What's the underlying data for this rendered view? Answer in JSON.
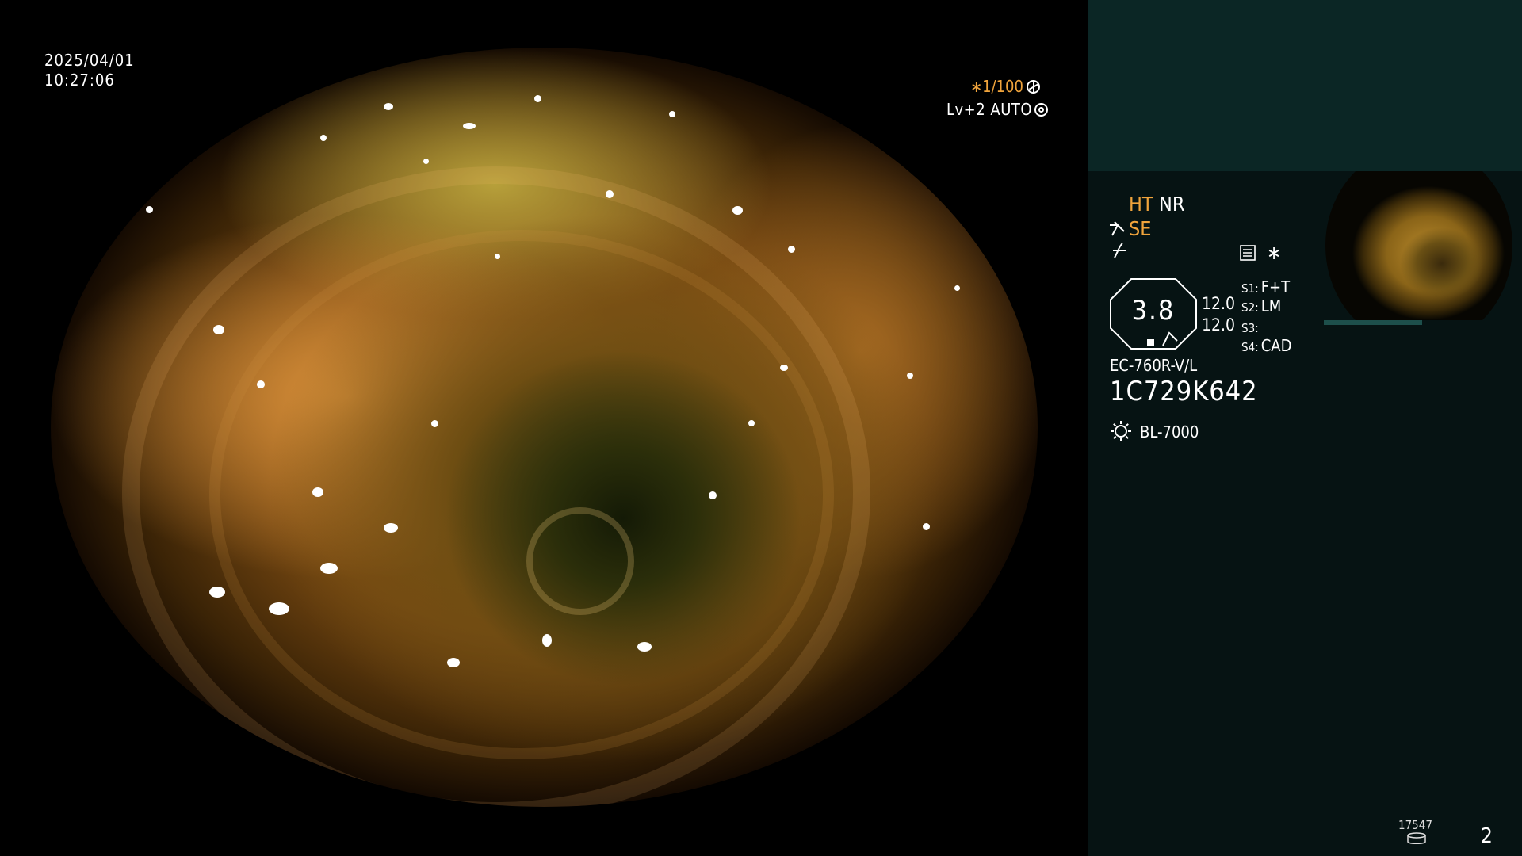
{
  "overlay": {
    "date": "2025/04/01",
    "time": "10:27:06",
    "shutter": "∗1/100",
    "level": "Lv+2 AUTO"
  },
  "panel": {
    "ht": "HT",
    "nr": "NR",
    "se": "SE",
    "star": "∗",
    "lens_value": "3.8",
    "dial_1": "12.0",
    "dial_2": "12.0",
    "slots": [
      {
        "key": "S1:",
        "value": "F+T"
      },
      {
        "key": "S2:",
        "value": "LM"
      },
      {
        "key": "S3:",
        "value": ""
      },
      {
        "key": "S4:",
        "value": "CAD"
      }
    ],
    "scope_model": "EC-760R-V/L",
    "scope_serial": "1C729K642",
    "light_source": "BL-7000",
    "record_count": "17547",
    "page_number": "2"
  },
  "colors": {
    "accent_orange": "#f0a43c",
    "panel_top": "#0b2625",
    "panel_bottom": "#061313"
  },
  "icons": {
    "shutter": "aperture-icon",
    "auto": "auto-exposure-icon",
    "se": "structure-enhance-icon",
    "f": "freeze-icon",
    "mode": "mode-icon",
    "light": "light-source-icon",
    "record": "storage-disk-icon"
  }
}
